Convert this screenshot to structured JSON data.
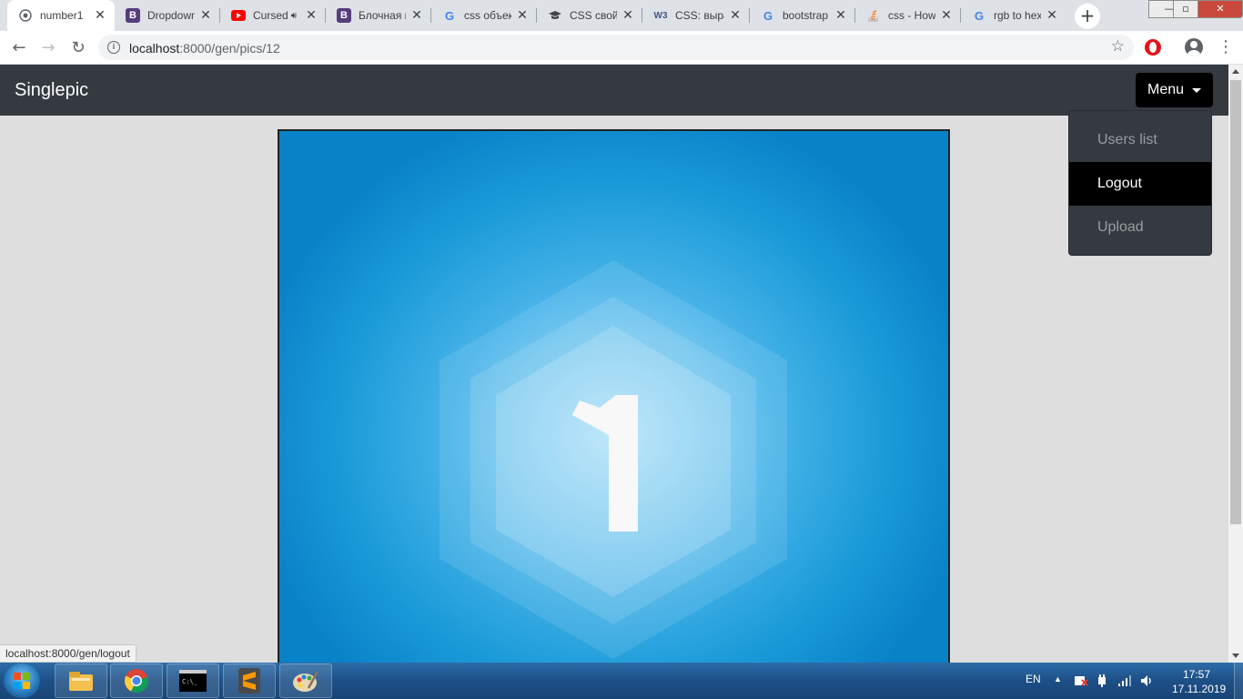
{
  "browser": {
    "tabs": [
      {
        "title": "number1",
        "favicon": "globe-icon",
        "active": true
      },
      {
        "title": "Dropdowns",
        "favicon": "bootstrap-icon",
        "active": false
      },
      {
        "title": "Cursed",
        "favicon": "youtube-icon",
        "active": false,
        "audio": true
      },
      {
        "title": "Блочная модель",
        "favicon": "bootstrap-icon",
        "active": false
      },
      {
        "title": "css объект",
        "favicon": "google-icon",
        "active": false
      },
      {
        "title": "CSS свойства",
        "favicon": "graduation-cap-icon",
        "active": false
      },
      {
        "title": "CSS: выравнивание",
        "favicon": "w3schools-icon",
        "active": false
      },
      {
        "title": "bootstrap",
        "favicon": "google-icon",
        "active": false
      },
      {
        "title": "css - How",
        "favicon": "stackoverflow-icon",
        "active": false
      },
      {
        "title": "rgb to hex",
        "favicon": "google-icon",
        "active": false
      }
    ],
    "address": {
      "host": "localhost",
      "path": ":8000/gen/pics/12"
    },
    "status_link": "localhost:8000/gen/logout"
  },
  "page": {
    "brand": "Singlepic",
    "menu_label": "Menu",
    "dropdown": [
      {
        "label": "Users list",
        "active": false
      },
      {
        "label": "Logout",
        "active": true
      },
      {
        "label": "Upload",
        "active": false
      }
    ],
    "picture_glyph": "1"
  },
  "taskbar": {
    "language": "EN",
    "time": "17:57",
    "date": "17.11.2019",
    "apps": [
      "windows-explorer-icon",
      "chrome-icon",
      "cmd-icon",
      "sublime-text-icon",
      "paint-icon"
    ]
  },
  "colors": {
    "navbar": "#343a40",
    "menu_button": "#000000",
    "dropdown_active": "#000000",
    "picture_blue": "#1a9ad8"
  }
}
